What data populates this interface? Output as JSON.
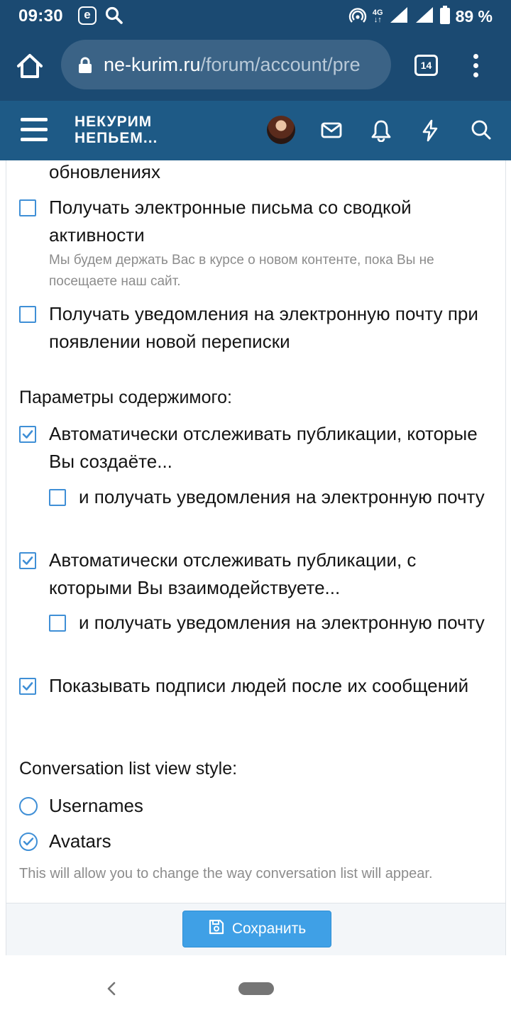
{
  "status_bar": {
    "time": "09:30",
    "network": "4G",
    "battery": "89 %"
  },
  "browser": {
    "url_host": "ne-kurim.ru",
    "url_path": "/forum/account/pre",
    "tab_count": "14"
  },
  "site_header": {
    "logo_line1": "НЕКУРИМ",
    "logo_line2": "НЕПЬЕМ..."
  },
  "preferences": {
    "top_cut_text": "обновлениях",
    "email_digest": {
      "label": "Получать электронные письма со сводкой активности",
      "hint": "Мы будем держать Вас в курсе о новом контенте, пока Вы не посещаете наш сайт.",
      "checked": false
    },
    "email_conversation": {
      "label": "Получать уведомления на электронную почту при появлении новой переписки",
      "checked": false
    },
    "content_group_title": "Параметры содержимого:",
    "watch_created": {
      "label": "Автоматически отслеживать публикации, которые Вы создаёте...",
      "checked": true
    },
    "watch_created_email": {
      "label": "и получать уведомления на электронную почту",
      "checked": false
    },
    "watch_interacted": {
      "label": "Автоматически отслеживать публикации, с которыми Вы взаимодействуете...",
      "checked": true
    },
    "watch_interacted_email": {
      "label": "и получать уведомления на электронную почту",
      "checked": false
    },
    "show_signatures": {
      "label": "Показывать подписи людей после их сообщений",
      "checked": true
    },
    "view_style_title": "Conversation list view style:",
    "view_style_options": [
      {
        "label": "Usernames",
        "selected": false
      },
      {
        "label": "Avatars",
        "selected": true
      }
    ],
    "view_style_hint": "This will allow you to change the way conversation list will appear."
  },
  "footer": {
    "save_label": "Сохранить"
  },
  "colors": {
    "status_bar": "#1b4a72",
    "site_header": "#1e5a86",
    "accent": "#3f8fd6",
    "button": "#3fa0e6"
  }
}
